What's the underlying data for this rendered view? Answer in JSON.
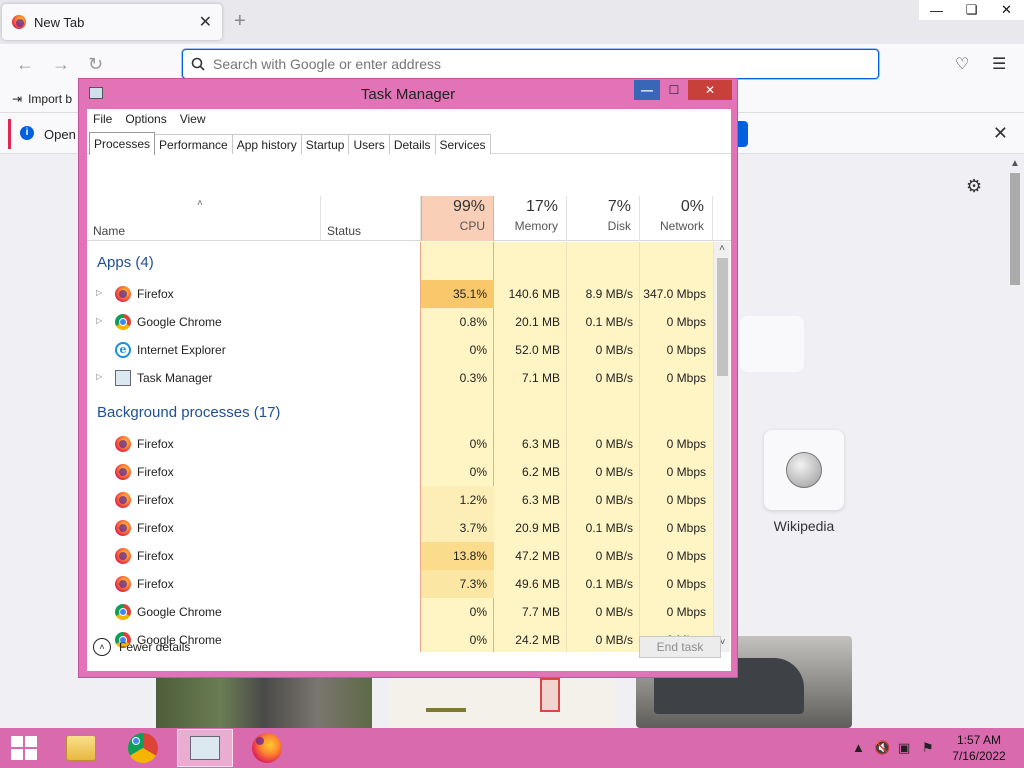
{
  "browser": {
    "tab_title": "New Tab",
    "new_tab_symbol": "+",
    "url_placeholder": "Search with Google or enter address",
    "bookmarks_item": "Import b",
    "infobar_text": "Open p",
    "top_site_label": "Wikipedia",
    "window_controls": [
      "—",
      "❏",
      "✕"
    ]
  },
  "task_manager": {
    "title": "Task Manager",
    "menu": [
      "File",
      "Options",
      "View"
    ],
    "tabs": [
      "Processes",
      "Performance",
      "App history",
      "Startup",
      "Users",
      "Details",
      "Services"
    ],
    "columns": {
      "name": "Name",
      "status": "Status",
      "cpu": {
        "pct": "99%",
        "label": "CPU"
      },
      "memory": {
        "pct": "17%",
        "label": "Memory"
      },
      "disk": {
        "pct": "7%",
        "label": "Disk"
      },
      "network": {
        "pct": "0%",
        "label": "Network"
      }
    },
    "groups": {
      "apps": "Apps (4)",
      "background": "Background processes (17)"
    },
    "apps": [
      {
        "name": "Firefox",
        "icon": "firefox-icon",
        "expand": true,
        "cpu": "35.1%",
        "memory": "140.6 MB",
        "disk": "8.9 MB/s",
        "network": "347.0 Mbps"
      },
      {
        "name": "Google Chrome",
        "icon": "chrome-icon",
        "expand": true,
        "cpu": "0.8%",
        "memory": "20.1 MB",
        "disk": "0.1 MB/s",
        "network": "0 Mbps"
      },
      {
        "name": "Internet Explorer",
        "icon": "internet-explorer-icon",
        "expand": false,
        "cpu": "0%",
        "memory": "52.0 MB",
        "disk": "0 MB/s",
        "network": "0 Mbps"
      },
      {
        "name": "Task Manager",
        "icon": "task-manager-icon",
        "expand": true,
        "cpu": "0.3%",
        "memory": "7.1 MB",
        "disk": "0 MB/s",
        "network": "0 Mbps"
      }
    ],
    "background": [
      {
        "name": "Firefox",
        "icon": "firefox-icon",
        "cpu": "0%",
        "memory": "6.3 MB",
        "disk": "0 MB/s",
        "network": "0 Mbps"
      },
      {
        "name": "Firefox",
        "icon": "firefox-icon",
        "cpu": "0%",
        "memory": "6.2 MB",
        "disk": "0 MB/s",
        "network": "0 Mbps"
      },
      {
        "name": "Firefox",
        "icon": "firefox-icon",
        "cpu": "1.2%",
        "memory": "6.3 MB",
        "disk": "0 MB/s",
        "network": "0 Mbps"
      },
      {
        "name": "Firefox",
        "icon": "firefox-icon",
        "cpu": "3.7%",
        "memory": "20.9 MB",
        "disk": "0.1 MB/s",
        "network": "0 Mbps"
      },
      {
        "name": "Firefox",
        "icon": "firefox-icon",
        "cpu": "13.8%",
        "memory": "47.2 MB",
        "disk": "0 MB/s",
        "network": "0 Mbps"
      },
      {
        "name": "Firefox",
        "icon": "firefox-icon",
        "cpu": "7.3%",
        "memory": "49.6 MB",
        "disk": "0.1 MB/s",
        "network": "0 Mbps"
      },
      {
        "name": "Google Chrome",
        "icon": "chrome-icon",
        "cpu": "0%",
        "memory": "7.7 MB",
        "disk": "0 MB/s",
        "network": "0 Mbps"
      },
      {
        "name": "Google Chrome",
        "icon": "chrome-icon",
        "cpu": "0%",
        "memory": "24.2 MB",
        "disk": "0 MB/s",
        "network": "0 Mbps"
      }
    ],
    "fewer_details": "Fewer details",
    "end_task": "End task"
  },
  "taskbar": {
    "time": "1:57 AM",
    "date": "7/16/2022"
  },
  "colors": {
    "accent_window": "#e273b6",
    "taskbar": "#d96aae",
    "cpu_heat_high": "#f9c86b",
    "cpu_heat_low": "#fff4c4",
    "group_header": "#1e4f96"
  }
}
